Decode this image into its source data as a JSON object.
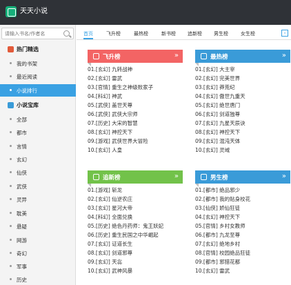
{
  "app": {
    "title": "天天小说"
  },
  "search": {
    "placeholder": "请输入书名/作者名"
  },
  "sidebar": {
    "sections": [
      {
        "title": "热门精选",
        "items": [
          "我的书架",
          "最近阅读",
          "小说排行"
        ]
      },
      {
        "title": "小说宝库",
        "items": [
          "全部",
          "都市",
          "言情",
          "玄幻",
          "仙侠",
          "武侠",
          "灵异",
          "耽美",
          "悬疑",
          "网游",
          "奇幻",
          "军事",
          "历史"
        ]
      }
    ],
    "active_item": "小说排行"
  },
  "tabs": [
    "首页",
    "飞升榜",
    "最热榜",
    "新书榜",
    "追新榜",
    "男生榜",
    "女生榜"
  ],
  "tab_more": "›",
  "panels": {
    "feisheng": {
      "title": "飞升榜",
      "more": "»",
      "items": [
        "01.[玄幻] 九转战神",
        "02.[玄幻] 雷武",
        "03.[官情] 重生之神级败家子",
        "04.[科幻] 神武",
        "05.[武侠] 盖世天尊",
        "06.[武侠] 武侠大宗师",
        "07.[历史] 大宋的智慧",
        "08.[玄幻] 神控天下",
        "09.[游戏] 武侠世界大冒险",
        "10.[玄幻] 人皇"
      ]
    },
    "zuire": {
      "title": "最热榜",
      "more": "»",
      "items": [
        "01.[玄幻] 大主宰",
        "02.[玄幻] 完美世界",
        "03.[玄幻] 莽荒纪",
        "04.[玄幻] 傲世九重天",
        "05.[玄幻] 绝世唐门",
        "06.[玄幻] 剑道独尊",
        "07.[玄幻] 九星天辰诀",
        "08.[玄幻] 神控天下",
        "09.[玄幻] 混沌天体",
        "10.[玄幻] 灵域"
      ]
    },
    "zhuixin": {
      "title": "追新榜",
      "more": "»",
      "items": [
        "01.[游戏] 斩龙",
        "02.[玄幻] 仙逆农庄",
        "03.[玄幻] 星河大帝",
        "04.[科幻] 全面兑换",
        "05.[历史] 绝色丹药师：鬼王妖妃",
        "06.[历史] 重生民国之中华崛起",
        "07.[玄幻] 证道长生",
        "08.[玄幻] 剑道邪尊",
        "09.[玄幻] 天惢",
        "10.[玄幻] 武神风暴"
      ]
    },
    "nansheng": {
      "title": "男生榜",
      "more": "»",
      "items": [
        "01.[都市] 绝品邪少",
        "02.[都市] 我的贴身校花",
        "03.[仙侠] 娇仙狂徒",
        "04.[玄幻] 神控天下",
        "05.[官情] 乡村女教师",
        "06.[都市] 九龙至尊",
        "07.[玄幻] 绝地乡村",
        "08.[官情] 校园绝品狂徒",
        "09.[都市] 邪猎花都",
        "10.[玄幻] 雷武"
      ]
    }
  },
  "colors": {
    "accent": "#3aa1e3",
    "red": "#f36464",
    "blue": "#3a9bd8",
    "green": "#72c24a",
    "titlebar": "#2f3237"
  }
}
